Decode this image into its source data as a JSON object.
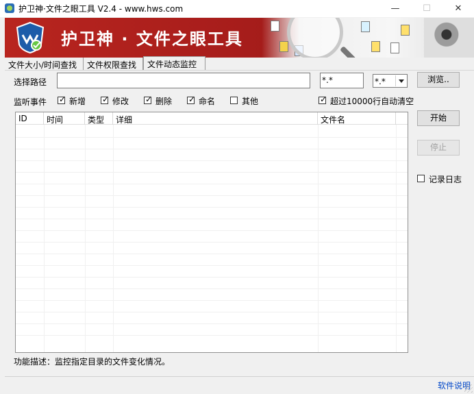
{
  "window": {
    "title": "护卫神·文件之眼工具 V2.4 - www.hws.com",
    "controls": {
      "minimize": "—",
      "maximize": "☐",
      "close": "✕"
    }
  },
  "banner": {
    "title": "护卫神 · 文件之眼工具",
    "colors": {
      "primary": "#b8251f",
      "text": "#ffffff"
    }
  },
  "tabs": [
    "文件大小/时间查找",
    "文件权限查找",
    "文件动态监控"
  ],
  "path": {
    "label": "选择路径",
    "value": "",
    "pattern": "*.*",
    "select_value": "*.*",
    "browse_label": "浏览.."
  },
  "events": {
    "label": "监听事件",
    "items": [
      {
        "label": "新增",
        "checked": true
      },
      {
        "label": "修改",
        "checked": true
      },
      {
        "label": "删除",
        "checked": true
      },
      {
        "label": "命名",
        "checked": true
      },
      {
        "label": "其他",
        "checked": false
      }
    ],
    "auto_clear": {
      "label": "超过10000行自动清空",
      "checked": true
    }
  },
  "table": {
    "columns": [
      "ID",
      "时间",
      "类型",
      "详细",
      "文件名"
    ],
    "rows": []
  },
  "actions": {
    "start": "开始",
    "stop": "停止",
    "log": {
      "label": "记录日志",
      "checked": false
    }
  },
  "description": "功能描述：监控指定目录的文件变化情况。",
  "status": {
    "help_link": "软件说明"
  }
}
